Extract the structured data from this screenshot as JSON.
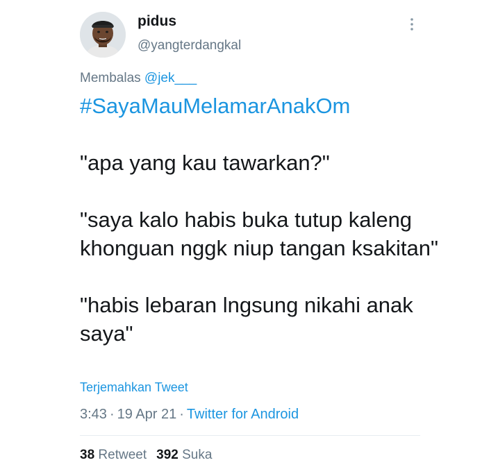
{
  "author": {
    "display_name": "pidus",
    "handle": "@yangterdangkal"
  },
  "reply": {
    "prefix": "Membalas ",
    "target": "@jek___"
  },
  "tweet": {
    "hashtag": "#SayaMauMelamarAnakOm",
    "paragraphs": [
      "\"apa yang kau tawarkan?\"",
      "\"saya kalo habis buka tutup kaleng khonguan nggk niup tangan ksakitan\"",
      "\"habis lebaran lngsung nikahi anak saya\""
    ]
  },
  "translate_label": "Terjemahkan Tweet",
  "meta": {
    "time": "3:43",
    "sep": "·",
    "date": "19 Apr 21",
    "source": "Twitter for Android"
  },
  "stats": {
    "retweet_count": "38",
    "retweet_label": "Retweet",
    "like_count": "392",
    "like_label": "Suka"
  },
  "icons": {
    "more": "more-vertical-icon",
    "avatar": "profile-photo"
  },
  "colors": {
    "link": "#1b95e0",
    "muted": "#657786",
    "text": "#14171a"
  }
}
